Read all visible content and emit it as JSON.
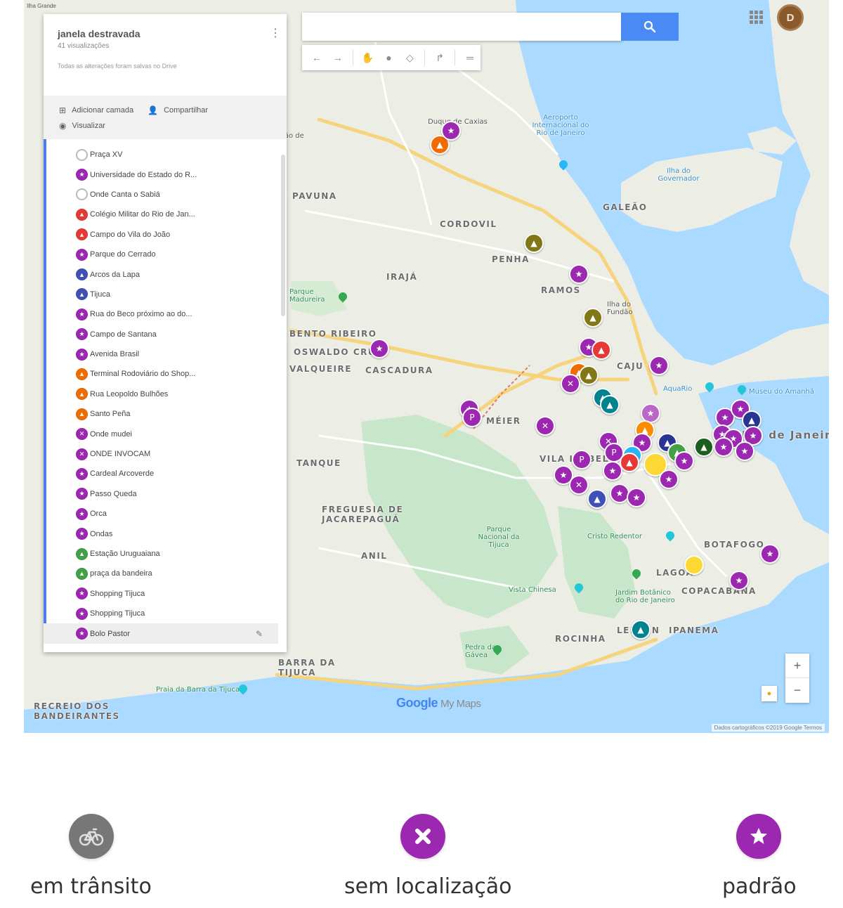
{
  "colors": {
    "purple": "#9c27b0",
    "orange": "#ef6c00",
    "red": "#e53935",
    "olive": "#827717",
    "navy": "#283593",
    "indigo": "#3f51b5",
    "green": "#43a047",
    "dark_green": "#1b5e20",
    "teal": "#00838f",
    "yellow": "#fdd835",
    "gray": "#777777",
    "water": "#aadaff",
    "park": "#c8e6c9",
    "search_button": "#4a8af4"
  },
  "map": {
    "corner_label": "Ilha Grande",
    "search": {
      "placeholder": "",
      "button_icon": "search-icon"
    },
    "toolbar_icons": [
      "undo-icon",
      "redo-icon",
      "hand-icon",
      "marker-icon",
      "polygon-icon",
      "route-icon",
      "ruler-icon"
    ],
    "user_avatar_letter": "D",
    "zoom_in": "+",
    "zoom_out": "−",
    "google_logo": "Google",
    "google_logo_suffix": "My Maps",
    "attribution": "Dados cartográficos ©2019 Google    Termos",
    "places": {
      "duque_de_caxias": "Duque de Caxias",
      "sao_joao_meriti": "São João de Meriti",
      "pavuna": "PAVUNA",
      "cordovil": "CORDOVIL",
      "galeao": "GALEÃO",
      "penha": "PENHA",
      "iraja": "IRAJÁ",
      "ramos": "RAMOS",
      "ilha_fundao": "Ilha do Fundão",
      "caju": "CAJU",
      "bento_ribeiro": "BENTO RIBEIRO",
      "oswaldo_cruz": "OSWALDO CRUZ",
      "cascadura": "CASCADURA",
      "valqueire": "VALQUEIRE",
      "meier": "MÉIER",
      "rio": "Rio de Janeiro",
      "tanque": "TANQUE",
      "vila_isabel": "VILA ISABEL",
      "freguesia": "FREGUESIA DE JACAREPAGUÁ",
      "anil": "ANIL",
      "botafogo": "BOTAFOGO",
      "lagoa": "LAGOA",
      "copacabana": "COPACABANA",
      "leblon": "LEBLON",
      "ipanema": "IPANEMA",
      "rocinha": "ROCINHA",
      "barra_tijuca": "BARRA DA TIJUCA",
      "recreio": "RECREIO DOS BANDEIRANTES",
      "ilha_governador": "Ilha do Governador",
      "parque_madureira": "Parque Madureira",
      "parque_nacional_tijuca": "Parque Nacional da Tijuca",
      "cristo": "Cristo Redentor",
      "vista_chinesa": "Vista Chinesa",
      "jardim_botanico": "Jardim Botânico do Rio de Janeiro",
      "praia_barra": "Praia da Barra da Tijuca",
      "pedra_gavea": "Pedra da Gávea",
      "museu_amanha": "Museu do Amanhã",
      "aquario": "AquaRio",
      "aeroporto_galeao": "Aeroporto Internacional do Rio de Janeiro",
      "jardim_botanico_short": "Jardim Botânico"
    }
  },
  "panel": {
    "title": "janela destravada",
    "views": "41 visualizações",
    "saved_note": "Todas as alterações foram salvas no Drive",
    "add_layer": "Adicionar camada",
    "share": "Compartilhar",
    "preview": "Visualizar",
    "items": [
      {
        "label": "Praça XV",
        "color": "empty",
        "icon": ""
      },
      {
        "label": "Universidade do Estado do R...",
        "color": "purple",
        "icon": "★"
      },
      {
        "label": "Onde Canta o Sabiá",
        "color": "empty",
        "icon": ""
      },
      {
        "label": "Colégio Militar do Rio de Jan...",
        "color": "red",
        "icon": "▲"
      },
      {
        "label": "Campo do Vila do João",
        "color": "red",
        "icon": "▲"
      },
      {
        "label": "Parque do Cerrado",
        "color": "purple",
        "icon": "★"
      },
      {
        "label": "Arcos da Lapa",
        "color": "indigo",
        "icon": "▲"
      },
      {
        "label": "Tijuca",
        "color": "indigo",
        "icon": "▲"
      },
      {
        "label": "Rua do Beco próximo ao do...",
        "color": "purple",
        "icon": "★"
      },
      {
        "label": "Campo de Santana",
        "color": "purple",
        "icon": "★"
      },
      {
        "label": "Avenida Brasil",
        "color": "purple",
        "icon": "★"
      },
      {
        "label": "Terminal Rodoviário do Shop...",
        "color": "orange",
        "icon": "▲"
      },
      {
        "label": "Rua Leopoldo Bulhões",
        "color": "orange",
        "icon": "▲"
      },
      {
        "label": "Santo Peña",
        "color": "orange",
        "icon": "▲"
      },
      {
        "label": "Onde mudei",
        "color": "purple",
        "icon": "✕"
      },
      {
        "label": "ONDE INVOCAM",
        "color": "purple",
        "icon": "✕"
      },
      {
        "label": "Cardeal Arcoverde",
        "color": "purple",
        "icon": "★"
      },
      {
        "label": "Passo Queda",
        "color": "purple",
        "icon": "★"
      },
      {
        "label": "Orca",
        "color": "purple",
        "icon": "★"
      },
      {
        "label": "Ondas",
        "color": "purple",
        "icon": "★"
      },
      {
        "label": "Estação Uruguaiana",
        "color": "green",
        "icon": "▲"
      },
      {
        "label": "praça da bandeira",
        "color": "green",
        "icon": "▲"
      },
      {
        "label": "Shopping Tijuca",
        "color": "purple",
        "icon": "★"
      },
      {
        "label": "Shopping Tijuca",
        "color": "purple",
        "icon": "★"
      },
      {
        "label": "Bolo Pastor",
        "color": "purple",
        "icon": "★"
      }
    ]
  },
  "legend": [
    {
      "label": "em trânsito",
      "icon": "bicycle-icon",
      "color": "#777777"
    },
    {
      "label": "sem localização",
      "icon": "close-icon",
      "color": "#9c27b0"
    },
    {
      "label": "padrão",
      "icon": "star-icon",
      "color": "#9c27b0"
    }
  ]
}
